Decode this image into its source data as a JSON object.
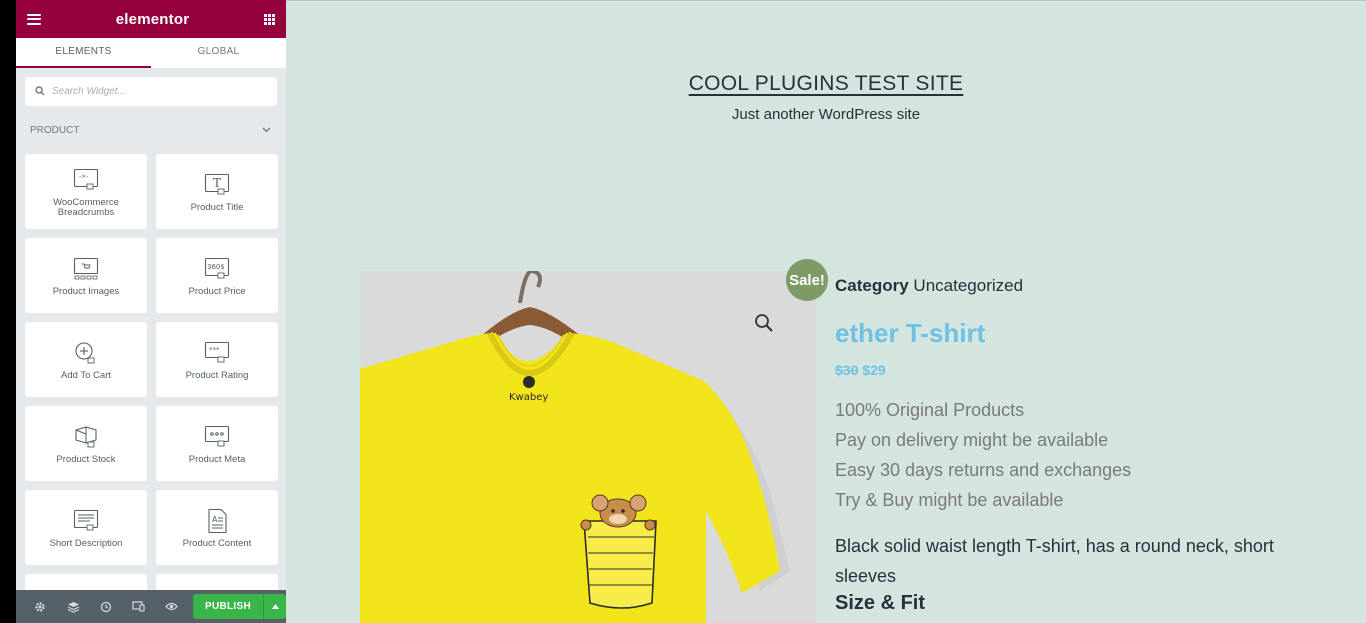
{
  "panel": {
    "brand": "elementor",
    "tabs": [
      {
        "label": "ELEMENTS",
        "active": true
      },
      {
        "label": "GLOBAL",
        "active": false
      }
    ],
    "search": {
      "placeholder": "Search Widget..."
    },
    "category": "PRODUCT",
    "widgets": [
      {
        "label": "WooCommerce Breadcrumbs",
        "icon": "breadcrumbs-icon"
      },
      {
        "label": "Product Title",
        "icon": "title-icon"
      },
      {
        "label": "Product Images",
        "icon": "images-icon"
      },
      {
        "label": "Product Price",
        "icon": "price-icon"
      },
      {
        "label": "Add To Cart",
        "icon": "add-to-cart-icon"
      },
      {
        "label": "Product Rating",
        "icon": "rating-icon"
      },
      {
        "label": "Product Stock",
        "icon": "stock-icon"
      },
      {
        "label": "Product Meta",
        "icon": "meta-icon"
      },
      {
        "label": "Short Description",
        "icon": "short-description-icon"
      },
      {
        "label": "Product Content",
        "icon": "content-icon"
      }
    ],
    "footer": {
      "publish_label": "PUBLISH",
      "icons": [
        "settings-icon",
        "navigator-icon",
        "history-icon",
        "responsive-icon",
        "preview-icon"
      ]
    }
  },
  "site": {
    "title": "COOL PLUGINS TEST SITE",
    "tagline": "Just another WordPress site"
  },
  "product": {
    "sale_badge": "Sale!",
    "category_label": "Category",
    "category_value": "Uncategorized",
    "title": "ether T-shirt",
    "old_price": "$30",
    "price": "$29",
    "features": [
      "100% Original Products",
      "Pay on delivery might be available",
      "Easy 30 days returns and exchanges",
      "Try & Buy might be available"
    ],
    "description": "Black solid waist length T-shirt, has a round neck, short sleeves",
    "size_heading": "Size & Fit",
    "shirt_brand": "Kwabey"
  },
  "colors": {
    "brand": "#93003c",
    "publish": "#39b54a",
    "preview_bg": "#d4e4df",
    "accent": "#6ec1e4",
    "sale": "#7e9a65"
  }
}
